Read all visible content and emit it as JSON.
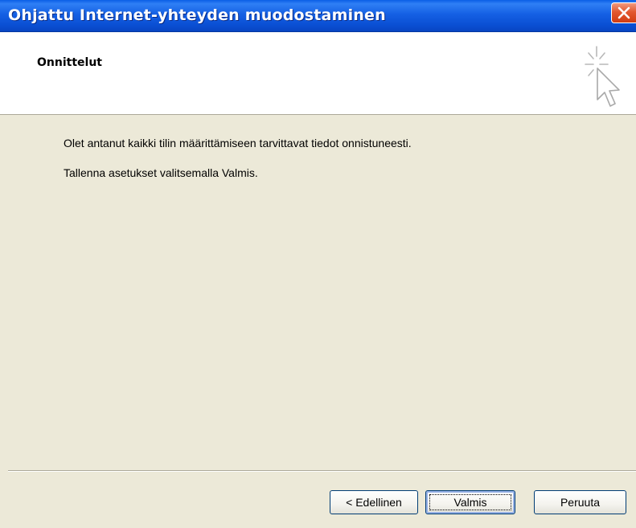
{
  "window": {
    "title": "Ohjattu Internet-yhteyden muodostaminen"
  },
  "header": {
    "title": "Onnittelut",
    "icon": "wizard-cursor-icon"
  },
  "body": {
    "line1": "Olet antanut kaikki tilin määrittämiseen tarvittavat tiedot onnistuneesti.",
    "line2": "Tallenna asetukset valitsemalla Valmis."
  },
  "buttons": {
    "back_label": "< Edellinen",
    "finish_label": "Valmis",
    "cancel_label": "Peruuta"
  },
  "colors": {
    "titlebar": "#0a4fd3",
    "close": "#d23d12",
    "dialog_bg": "#ece9d8",
    "header_bg": "#ffffff"
  }
}
